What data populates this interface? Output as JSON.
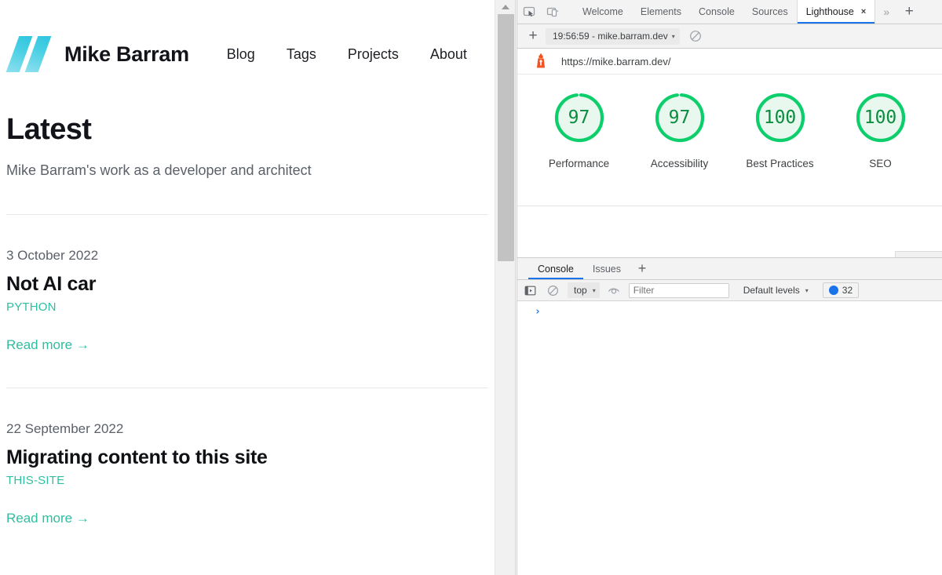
{
  "page": {
    "brand": "Mike Barram",
    "nav": [
      {
        "label": "Blog"
      },
      {
        "label": "Tags"
      },
      {
        "label": "Projects"
      },
      {
        "label": "About"
      }
    ],
    "theme_toggle_icon": "moon-icon",
    "theme_toggle_glyph": "☾",
    "heading": "Latest",
    "tagline": "Mike Barram's work as a developer and architect",
    "posts": [
      {
        "date": "3 October 2022",
        "title": "Not AI car",
        "tag": "PYTHON",
        "read_more": "Read more →"
      },
      {
        "date": "22 September 2022",
        "title": "Migrating content to this site",
        "tag": "THIS-SITE",
        "read_more": "Read more →"
      }
    ],
    "accent_color": "#31bda0",
    "logo_color": "#49cfe4"
  },
  "devtools": {
    "inspect_icon": "inspect-element-icon",
    "device_icon": "device-toolbar-icon",
    "tabs": [
      {
        "label": "Welcome",
        "active": false
      },
      {
        "label": "Elements",
        "active": false
      },
      {
        "label": "Console",
        "active": false
      },
      {
        "label": "Sources",
        "active": false
      },
      {
        "label": "Lighthouse",
        "active": true
      }
    ],
    "tab_close_glyph": "×",
    "more_tabs_glyph": "»",
    "add_tab_glyph": "+",
    "active_tab_underline_color": "#1a73e8"
  },
  "lighthouse": {
    "add_report_glyph": "+",
    "run_selector": "19:56:59 - mike.barram.dev",
    "run_selector_caret": "▾",
    "clear_icon": "clear-icon",
    "lighthouse_icon": "lighthouse-icon",
    "url": "https://mike.barram.dev/",
    "scores": [
      {
        "value": "97",
        "label": "Performance"
      },
      {
        "value": "97",
        "label": "Accessibility"
      },
      {
        "value": "100",
        "label": "Best Practices"
      },
      {
        "value": "100",
        "label": "SEO"
      }
    ],
    "pass_color": "#0cce6b",
    "score_text_color": "#0c8c3f"
  },
  "console": {
    "tabs": [
      {
        "label": "Console",
        "active": true
      },
      {
        "label": "Issues",
        "active": false
      }
    ],
    "add_tab_glyph": "+",
    "sidebar_toggle_icon": "console-sidebar-icon",
    "clear_console_icon": "clear-console-icon",
    "context": "top",
    "context_caret": "▾",
    "eye_icon": "live-expression-icon",
    "filter_placeholder": "Filter",
    "filter_value": "",
    "levels": "Default levels",
    "levels_caret": "▾",
    "message_count": "32",
    "message_badge_icon": "info-icon",
    "prompt_glyph": "›"
  },
  "scrollbar": {
    "up_arrow_icon": "scroll-up-arrow-icon"
  }
}
